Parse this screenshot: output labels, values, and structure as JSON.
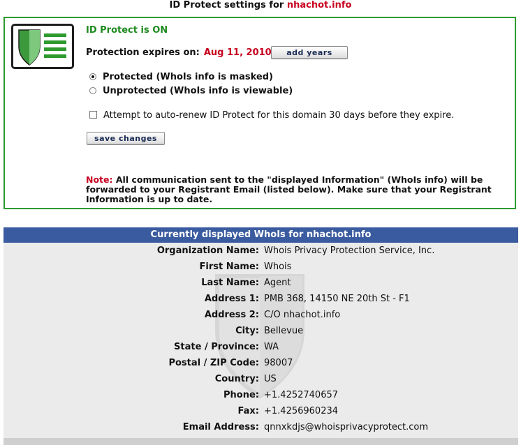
{
  "title": {
    "prefix": "ID Protect settings for",
    "domain": "nhachot.info"
  },
  "protect": {
    "status": "ID Protect is ON",
    "expires_label": "Protection expires on:",
    "expires_date": "Aug 11, 2010",
    "add_years_label": "add years",
    "options": [
      {
        "label": "Protected (WhoIs info is masked)",
        "selected": true
      },
      {
        "label": "Unprotected (WhoIs info is viewable)",
        "selected": false
      }
    ],
    "auto_renew_label": "Attempt to auto-renew ID Protect for this domain 30 days before they expire.",
    "auto_renew_checked": false,
    "save_label": "save changes",
    "note_label": "Note:",
    "note_text": "All communication sent to the \"displayed Information\" (WhoIs info) will be forwarded to your Registrant Email (listed below). Make sure that your Registrant Information is up to date."
  },
  "whois": {
    "header": "Currently displayed WhoIs for nhachot.info",
    "rows": [
      {
        "label": "Organization Name:",
        "value": "Whois Privacy Protection Service, Inc."
      },
      {
        "label": "First Name:",
        "value": "Whois"
      },
      {
        "label": "Last Name:",
        "value": "Agent"
      },
      {
        "label": "Address 1:",
        "value": "PMB 368, 14150 NE 20th St - F1"
      },
      {
        "label": "Address 2:",
        "value": "C/O nhachot.info"
      },
      {
        "label": "City:",
        "value": "Bellevue"
      },
      {
        "label": "State / Province:",
        "value": "WA"
      },
      {
        "label": "Postal / ZIP Code:",
        "value": "98007"
      },
      {
        "label": "Country:",
        "value": "US"
      },
      {
        "label": "Phone:",
        "value": "+1.4252740657"
      },
      {
        "label": "Fax:",
        "value": "+1.4256960234"
      },
      {
        "label": "Email Address:",
        "value": "qnnxkdjs@whoisprivacyprotect.com"
      }
    ]
  },
  "colors": {
    "accent_green": "#1f8a1f",
    "accent_red": "#c8001e",
    "header_blue": "#3a5b9f"
  },
  "icons": {
    "logo": "shield-document-icon",
    "watermark": "shield-watermark-icon"
  }
}
